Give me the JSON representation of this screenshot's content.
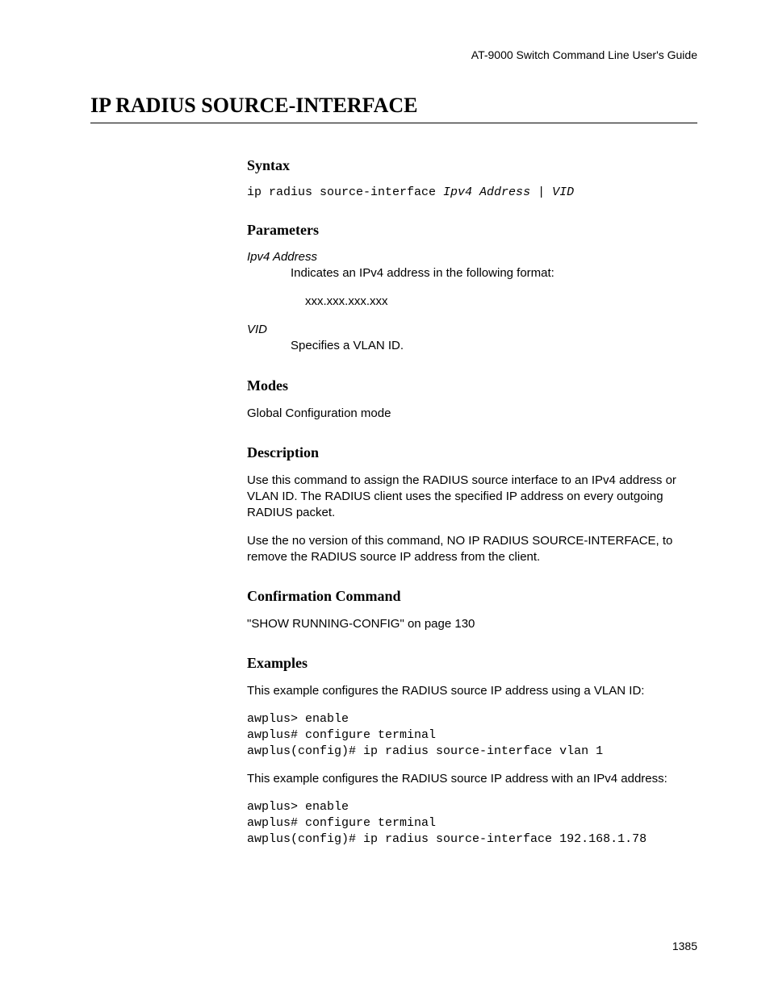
{
  "header": {
    "doc_title": "AT-9000 Switch Command Line User's Guide"
  },
  "page": {
    "title": "IP RADIUS SOURCE-INTERFACE",
    "number": "1385"
  },
  "sections": {
    "syntax": {
      "heading": "Syntax",
      "command_prefix": "ip radius source-interface ",
      "command_args": "Ipv4 Address | VID"
    },
    "parameters": {
      "heading": "Parameters",
      "items": [
        {
          "term": "Ipv4 Address",
          "desc": "Indicates an IPv4 address in the following format:",
          "sub": "xxx.xxx.xxx.xxx"
        },
        {
          "term": "VID",
          "desc": "Specifies a VLAN ID."
        }
      ]
    },
    "modes": {
      "heading": "Modes",
      "text": "Global Configuration mode"
    },
    "description": {
      "heading": "Description",
      "p1": "Use this command to assign the RADIUS source interface to an IPv4 address or VLAN ID. The RADIUS client uses the specified IP address on every outgoing RADIUS packet.",
      "p2": "Use the no version of this command, NO IP RADIUS SOURCE-INTERFACE, to remove the RADIUS source IP address from the client."
    },
    "confirmation": {
      "heading": "Confirmation Command",
      "text": "\"SHOW RUNNING-CONFIG\" on page 130"
    },
    "examples": {
      "heading": "Examples",
      "intro1": "This example configures the RADIUS source IP address using a VLAN ID:",
      "code1": "awplus> enable\nawplus# configure terminal\nawplus(config)# ip radius source-interface vlan 1",
      "intro2": "This example configures the RADIUS source IP address with an IPv4 address:",
      "code2": "awplus> enable\nawplus# configure terminal\nawplus(config)# ip radius source-interface 192.168.1.78"
    }
  }
}
